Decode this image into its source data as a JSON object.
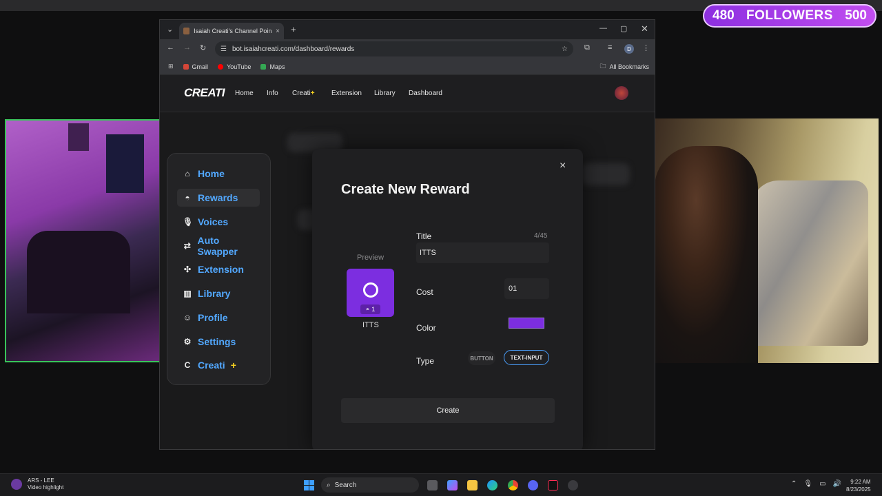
{
  "overlay": {
    "followers_current": "480",
    "followers_label": "FOLLOWERS",
    "followers_goal": "500"
  },
  "browser": {
    "tab_title": "Isaiah Creati's Channel Point B",
    "tab_close": "×",
    "new_tab": "+",
    "url": "bot.isaiahcreati.com/dashboard/rewards",
    "bookmarks": [
      "Gmail",
      "YouTube",
      "Maps"
    ],
    "all_bookmarks": "All Bookmarks",
    "profile_initial": "D"
  },
  "site": {
    "logo": "CREATI",
    "nav": [
      "Home",
      "Info",
      "Creati",
      "Extension",
      "Library",
      "Dashboard"
    ],
    "nav_creati_plus": "+",
    "sidebar": [
      {
        "label": "Home",
        "icon": "home-icon",
        "glyph": "⌂"
      },
      {
        "label": "Rewards",
        "icon": "rewards-icon",
        "glyph": "◓"
      },
      {
        "label": "Voices",
        "icon": "mic-icon",
        "glyph": "🎙"
      },
      {
        "label": "Auto Swapper",
        "icon": "swap-icon",
        "glyph": "⇄"
      },
      {
        "label": "Extension",
        "icon": "puzzle-icon",
        "glyph": "✣"
      },
      {
        "label": "Library",
        "icon": "library-icon",
        "glyph": "▥"
      },
      {
        "label": "Profile",
        "icon": "user-icon",
        "glyph": "☺"
      },
      {
        "label": "Settings",
        "icon": "gear-icon",
        "glyph": "⚙"
      },
      {
        "label": "Creati",
        "icon": "creati-icon",
        "glyph": "C"
      }
    ],
    "sidebar_creati_plus": "+",
    "active_item": "Rewards"
  },
  "modal": {
    "title": "Create New Reward",
    "close": "×",
    "preview_label": "Preview",
    "preview_cost": "1",
    "preview_name": "ITTS",
    "title_label": "Title",
    "title_count": "4/45",
    "title_value": "ITTS",
    "cost_label": "Cost",
    "cost_value": "01",
    "color_label": "Color",
    "color_value": "#7c2ee0",
    "type_label": "Type",
    "type_options": [
      "BUTTON",
      "TEXT-INPUT"
    ],
    "type_selected": "TEXT-INPUT",
    "create_label": "Create"
  },
  "taskbar": {
    "media_title": "ARS - LEE",
    "media_sub": "Video highlight",
    "search_placeholder": "Search",
    "time": "9:22 AM",
    "date": "8/23/2025"
  },
  "colors": {
    "accent_blue": "#52a8ff",
    "reward_purple": "#7c2ee0",
    "followers_bar": "#b040f0"
  }
}
